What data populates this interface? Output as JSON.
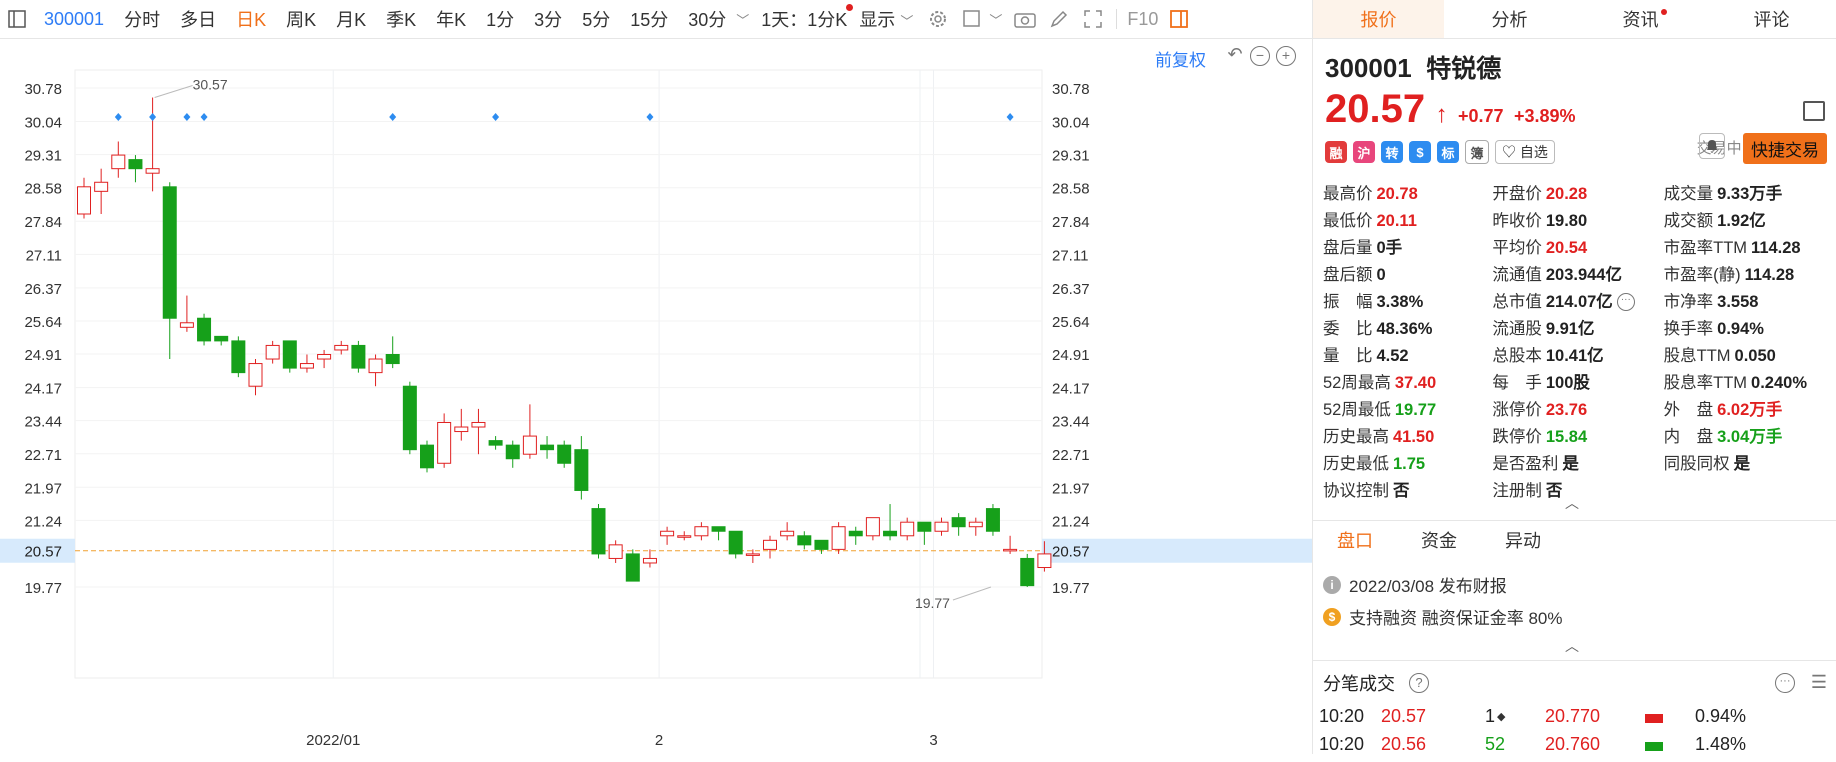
{
  "toolbar": {
    "code": "300001",
    "periods": [
      "分时",
      "多日",
      "日K",
      "周K",
      "月K",
      "季K",
      "年K",
      "1分",
      "3分",
      "5分",
      "15分",
      "30分"
    ],
    "active_period": "日K",
    "day_setting": "1天：1分K",
    "display": "显示",
    "f10": "F10"
  },
  "chart_header": {
    "fq_label": "前复权",
    "zoom_minus": "−",
    "zoom_plus": "+"
  },
  "colors": {
    "up": "#e02020",
    "down": "#16a01a",
    "accent": "#f0701a",
    "link": "#2d7cf6"
  },
  "chart_data": {
    "type": "candlestick",
    "y_ticks": [
      30.78,
      30.04,
      29.31,
      28.58,
      27.84,
      27.11,
      26.37,
      25.64,
      24.91,
      24.17,
      23.44,
      22.71,
      21.97,
      21.24,
      20.57,
      19.77
    ],
    "ylim": [
      19.4,
      31.2
    ],
    "x_labels": [
      {
        "label": "2022/01",
        "index": 15
      },
      {
        "label": "2",
        "index": 34
      },
      {
        "label": "3",
        "index": 50
      }
    ],
    "current_price": 20.57,
    "max_label": {
      "value": "30.57",
      "index": 4
    },
    "min_label": {
      "value": "19.77",
      "index": 53
    },
    "markers": [
      2,
      4,
      6,
      7,
      18,
      24,
      33,
      54
    ],
    "candles": [
      [
        28.0,
        28.6,
        28.8,
        27.9
      ],
      [
        28.5,
        28.7,
        29.0,
        28.0
      ],
      [
        29.0,
        29.3,
        29.6,
        28.8
      ],
      [
        29.2,
        29.0,
        29.3,
        28.7
      ],
      [
        28.9,
        29.0,
        30.57,
        28.5
      ],
      [
        28.6,
        25.7,
        28.7,
        24.8
      ],
      [
        25.5,
        25.6,
        26.2,
        25.4
      ],
      [
        25.7,
        25.2,
        25.8,
        25.1
      ],
      [
        25.3,
        25.2,
        25.3,
        25.1
      ],
      [
        25.2,
        24.5,
        25.3,
        24.4
      ],
      [
        24.2,
        24.7,
        24.8,
        24.0
      ],
      [
        24.8,
        25.1,
        25.2,
        24.7
      ],
      [
        25.2,
        24.6,
        25.2,
        24.5
      ],
      [
        24.6,
        24.7,
        24.9,
        24.5
      ],
      [
        24.8,
        24.9,
        25.0,
        24.6
      ],
      [
        25.0,
        25.1,
        25.2,
        24.9
      ],
      [
        25.1,
        24.6,
        25.2,
        24.5
      ],
      [
        24.5,
        24.8,
        24.9,
        24.2
      ],
      [
        24.9,
        24.7,
        25.3,
        24.6
      ],
      [
        24.2,
        22.8,
        24.3,
        22.7
      ],
      [
        22.9,
        22.4,
        23.0,
        22.3
      ],
      [
        22.5,
        23.4,
        23.6,
        22.4
      ],
      [
        23.2,
        23.3,
        23.7,
        23.0
      ],
      [
        23.3,
        23.4,
        23.7,
        22.7
      ],
      [
        23.0,
        22.9,
        23.1,
        22.8
      ],
      [
        22.9,
        22.6,
        23.0,
        22.4
      ],
      [
        22.7,
        23.1,
        23.8,
        22.6
      ],
      [
        22.9,
        22.8,
        23.1,
        22.6
      ],
      [
        22.9,
        22.5,
        23.0,
        22.4
      ],
      [
        22.8,
        21.9,
        23.1,
        21.7
      ],
      [
        21.5,
        20.5,
        21.6,
        20.4
      ],
      [
        20.4,
        20.7,
        20.8,
        20.3
      ],
      [
        20.5,
        19.9,
        20.6,
        19.9
      ],
      [
        20.3,
        20.4,
        20.6,
        20.2
      ],
      [
        20.9,
        21.0,
        21.1,
        20.7
      ],
      [
        20.9,
        20.9,
        21.0,
        20.8
      ],
      [
        20.9,
        21.1,
        21.2,
        20.8
      ],
      [
        21.1,
        21.0,
        21.1,
        20.8
      ],
      [
        21.0,
        20.5,
        21.0,
        20.4
      ],
      [
        20.5,
        20.5,
        20.6,
        20.3
      ],
      [
        20.6,
        20.8,
        20.9,
        20.4
      ],
      [
        20.9,
        21.0,
        21.2,
        20.8
      ],
      [
        20.9,
        20.7,
        21.0,
        20.6
      ],
      [
        20.8,
        20.6,
        20.8,
        20.5
      ],
      [
        20.6,
        21.1,
        21.2,
        20.5
      ],
      [
        21.0,
        20.9,
        21.1,
        20.7
      ],
      [
        20.9,
        21.3,
        21.3,
        20.8
      ],
      [
        21.0,
        20.9,
        21.6,
        20.8
      ],
      [
        20.9,
        21.2,
        21.3,
        20.8
      ],
      [
        21.2,
        21.0,
        21.2,
        20.7
      ],
      [
        21.0,
        21.2,
        21.3,
        20.9
      ],
      [
        21.3,
        21.1,
        21.4,
        20.9
      ],
      [
        21.1,
        21.2,
        21.3,
        20.9
      ],
      [
        21.5,
        21.0,
        21.6,
        20.9
      ],
      [
        20.6,
        20.6,
        20.9,
        20.5
      ],
      [
        20.4,
        19.8,
        20.5,
        19.77
      ],
      [
        20.2,
        20.5,
        20.78,
        20.11
      ]
    ]
  },
  "right": {
    "tabs": [
      "报价",
      "分析",
      "资讯",
      "评论"
    ],
    "code": "300001",
    "name": "特锐德",
    "price": "20.57",
    "arrow": "↑",
    "change": "+0.77",
    "change_pct": "+3.89%",
    "status": "交易中 03/08 10:20",
    "icon_tags": [
      "融",
      "沪",
      "转",
      "$",
      "标",
      "簿"
    ],
    "watch": "♡ 自选",
    "fast_trade": "快捷交易",
    "quotes": [
      [
        {
          "k": "最高价",
          "v": "20.78",
          "c": "red"
        },
        {
          "k": "开盘价",
          "v": "20.28",
          "c": "red"
        },
        {
          "k": "成交量",
          "v": "9.33万手",
          "c": ""
        }
      ],
      [
        {
          "k": "最低价",
          "v": "20.11",
          "c": "red"
        },
        {
          "k": "昨收价",
          "v": "19.80",
          "c": ""
        },
        {
          "k": "成交额",
          "v": "1.92亿",
          "c": ""
        }
      ],
      [
        {
          "k": "盘后量",
          "v": "0手",
          "c": ""
        },
        {
          "k": "平均价",
          "v": "20.54",
          "c": "red"
        },
        {
          "k": "市盈率TTM",
          "v": "114.28",
          "c": ""
        }
      ],
      [
        {
          "k": "盘后额",
          "v": "0",
          "c": ""
        },
        {
          "k": "流通值",
          "v": "203.944亿",
          "c": ""
        },
        {
          "k": "市盈率(静)",
          "v": "114.28",
          "c": ""
        }
      ],
      [
        {
          "k": "振　幅",
          "v": "3.38%",
          "c": ""
        },
        {
          "k": "总市值",
          "v": "214.07亿",
          "c": ""
        },
        {
          "k": "市净率",
          "v": "3.558",
          "c": ""
        }
      ],
      [
        {
          "k": "委　比",
          "v": "48.36%",
          "c": ""
        },
        {
          "k": "流通股",
          "v": "9.91亿",
          "c": ""
        },
        {
          "k": "换手率",
          "v": "0.94%",
          "c": ""
        }
      ],
      [
        {
          "k": "量　比",
          "v": "4.52",
          "c": ""
        },
        {
          "k": "总股本",
          "v": "10.41亿",
          "c": ""
        },
        {
          "k": "股息TTM",
          "v": "0.050",
          "c": ""
        }
      ],
      [
        {
          "k": "52周最高",
          "v": "37.40",
          "c": "red"
        },
        {
          "k": "每　手",
          "v": "100股",
          "c": ""
        },
        {
          "k": "股息率TTM",
          "v": "0.240%",
          "c": ""
        }
      ],
      [
        {
          "k": "52周最低",
          "v": "19.77",
          "c": "green"
        },
        {
          "k": "涨停价",
          "v": "23.76",
          "c": "red"
        },
        {
          "k": "外　盘",
          "v": "6.02万手",
          "c": "red"
        }
      ],
      [
        {
          "k": "历史最高",
          "v": "41.50",
          "c": "red"
        },
        {
          "k": "跌停价",
          "v": "15.84",
          "c": "green"
        },
        {
          "k": "内　盘",
          "v": "3.04万手",
          "c": "green"
        }
      ],
      [
        {
          "k": "历史最低",
          "v": "1.75",
          "c": "green"
        },
        {
          "k": "是否盈利",
          "v": "是",
          "c": ""
        },
        {
          "k": "同股同权",
          "v": "是",
          "c": ""
        }
      ],
      [
        {
          "k": "协议控制",
          "v": "否",
          "c": ""
        },
        {
          "k": "注册制",
          "v": "否",
          "c": ""
        },
        {
          "k": "",
          "v": "",
          "c": ""
        }
      ]
    ],
    "panel_tabs": [
      "盘口",
      "资金",
      "异动"
    ],
    "notices": [
      "2022/03/08 发布财报",
      "支持融资 融资保证金率 80%"
    ],
    "ticks_title": "分笔成交",
    "ticks": [
      {
        "time": "10:20",
        "price": "20.57",
        "vol": "1",
        "dir": "◆",
        "ob_price": "20.770",
        "pct": "0.94%"
      },
      {
        "time": "10:20",
        "price": "20.56",
        "vol": "52",
        "dir": "",
        "ob_price": "20.760",
        "pct": "1.48%"
      }
    ]
  }
}
